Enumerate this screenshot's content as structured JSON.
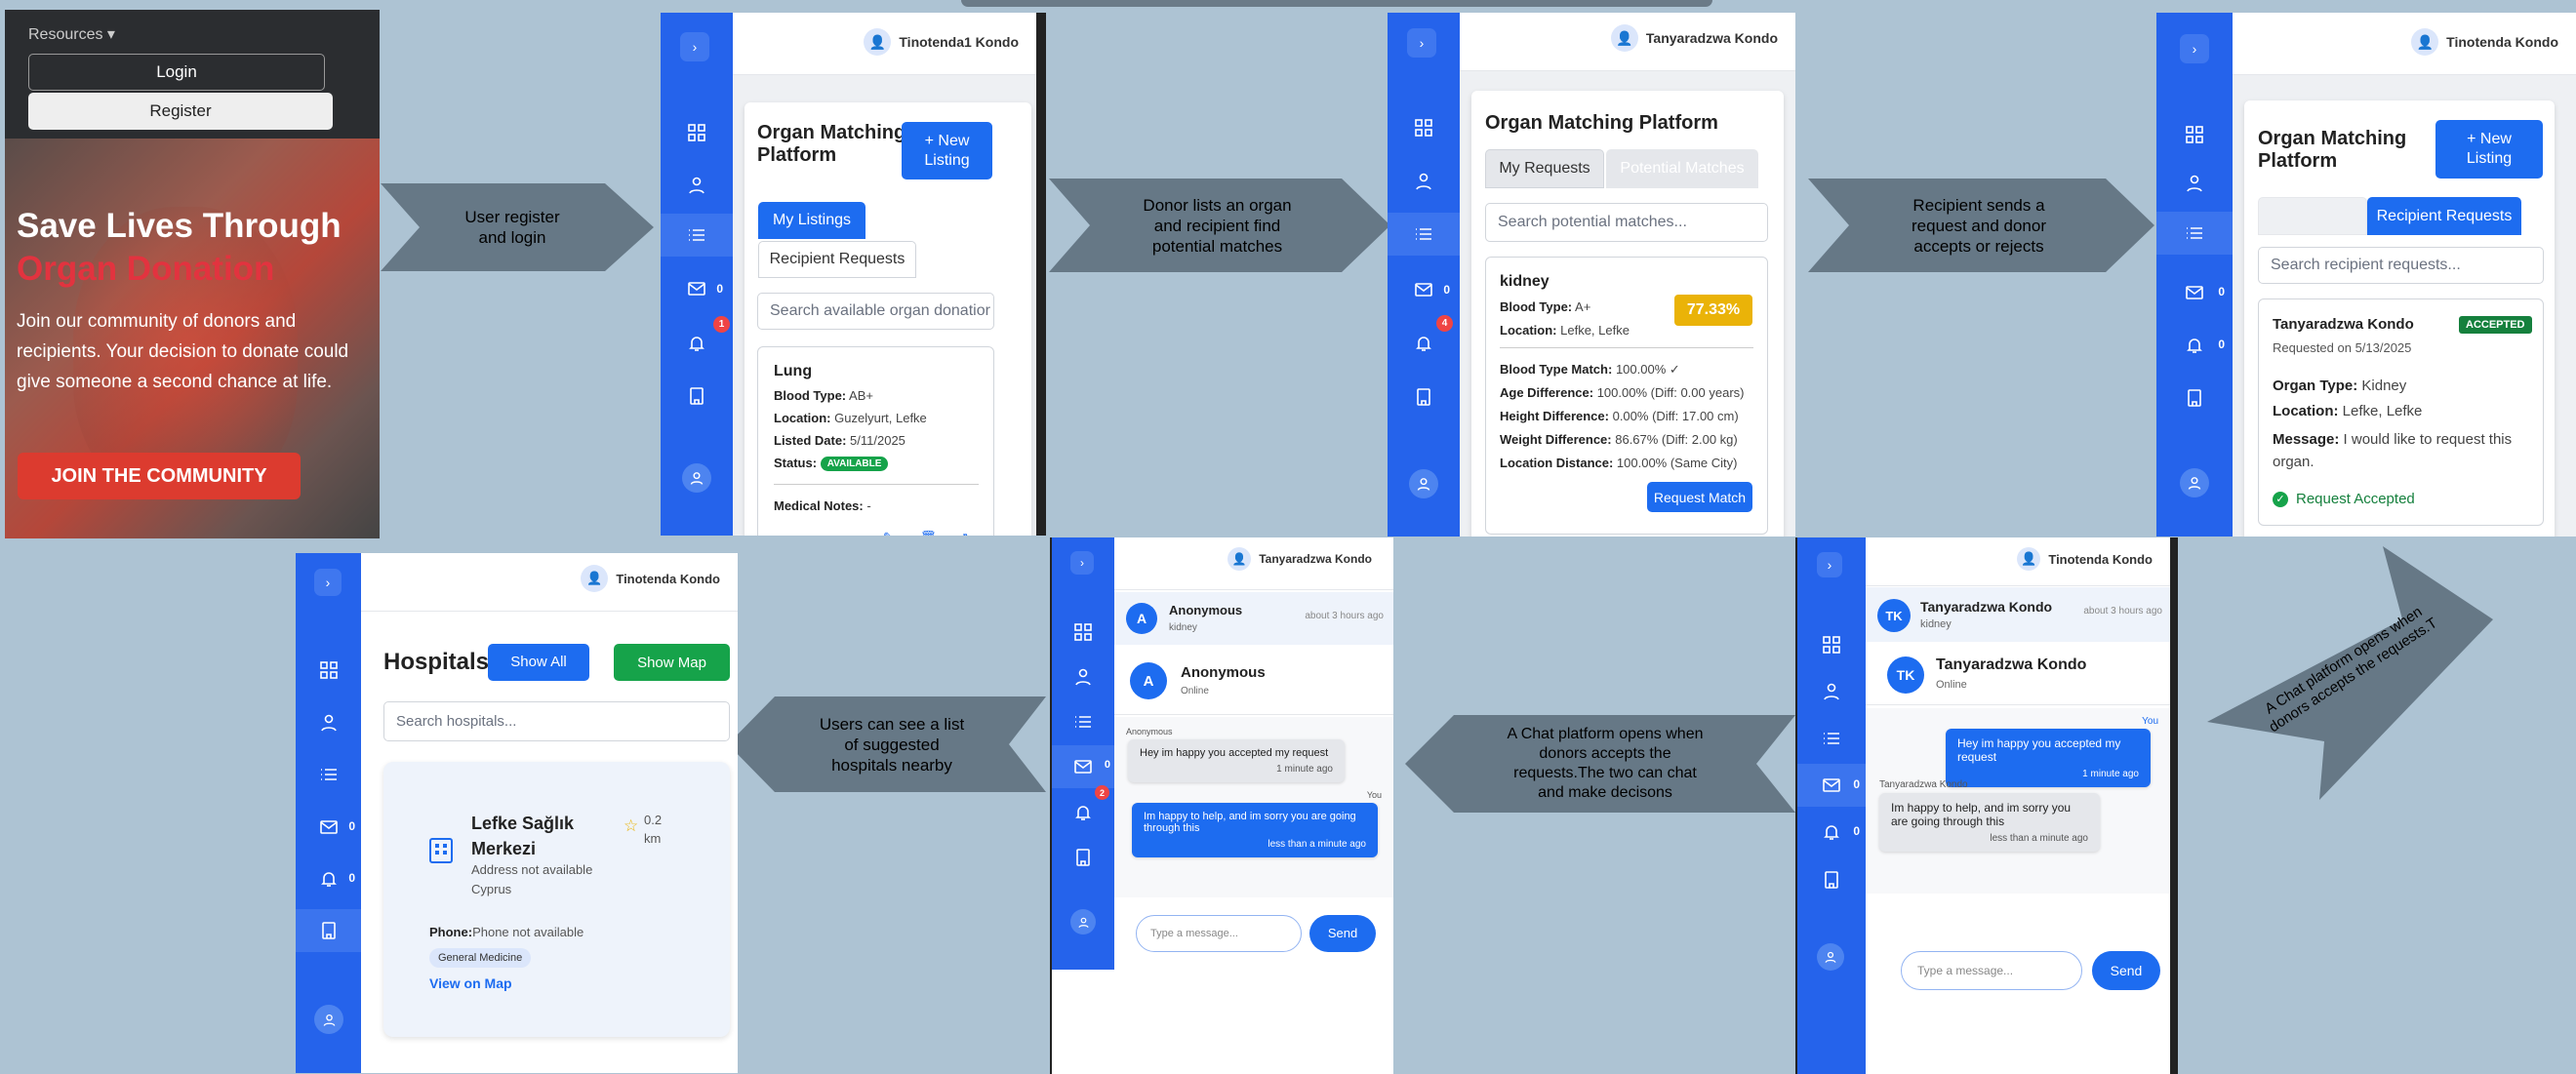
{
  "flow_labels": {
    "a1": [
      "User register",
      "and login"
    ],
    "a2": [
      "Donor lists an organ",
      "and recipient find",
      "potential matches"
    ],
    "a3": [
      "Recipient sends a",
      "request and donor",
      "accepts or rejects"
    ],
    "a4": [
      "A Chat platform opens when",
      "donors accepts the requests.T"
    ],
    "a5": [
      "A Chat platform opens when",
      "donors accepts the",
      "requests.The two can chat",
      "and make decisons"
    ],
    "a6": [
      "Users can see a list",
      "of suggested",
      "hospitals nearby"
    ]
  },
  "landing": {
    "resources": "Resources",
    "login": "Login",
    "register": "Register",
    "hero_line1": "Save Lives Through",
    "hero_line2": "Organ Donation",
    "body": "Join our community of donors and recipients. Your decision to donate could give someone a second chance at life.",
    "cta": "JOIN THE COMMUNITY"
  },
  "users": {
    "tinotenda1": "Tinotenda1 Kondo",
    "tanyaradzwa": "Tanyaradzwa Kondo",
    "tinotenda": "Tinotenda Kondo"
  },
  "platform_title": [
    "Organ Matching",
    "Platform"
  ],
  "platform_title_full": "Organ Matching Platform",
  "new_listing": [
    "+ New",
    "Listing"
  ],
  "s2": {
    "tab_my": "My Listings",
    "tab_req": "Recipient Requests",
    "search": "Search available organ donatior",
    "organ": "Lung",
    "blood_l": "Blood Type:",
    "blood": "AB+",
    "loc_l": "Location:",
    "loc": "Guzelyurt, Lefke",
    "date_l": "Listed Date:",
    "date": "5/11/2025",
    "status_l": "Status:",
    "status": "AVAILABLE",
    "notes_l": "Medical Notes:",
    "notes": "-",
    "mail_count": "0",
    "notif_badge": "1"
  },
  "s3": {
    "tab_my": "My Requests",
    "tab_pm": "Potential Matches",
    "search": "Search potential matches...",
    "organ": "kidney",
    "score": "77.33%",
    "blood_l": "Blood Type:",
    "blood": "A+",
    "loc_l": "Location:",
    "loc": "Lefke, Lefke",
    "m1_l": "Blood Type Match:",
    "m1": "100.00% ✓",
    "m2_l": "Age Difference:",
    "m2": "100.00% (Diff: 0.00 years)",
    "m3_l": "Height Difference:",
    "m3": "0.00% (Diff: 17.00 cm)",
    "m4_l": "Weight Difference:",
    "m4": "86.67% (Diff: 2.00 kg)",
    "m5_l": "Location Distance:",
    "m5": "100.00% (Same City)",
    "btn": "Request Match",
    "mail_count": "0",
    "notif_badge": "4"
  },
  "s4": {
    "tab_req": "Recipient Requests",
    "search": "Search recipient requests...",
    "name": "Tanyaradzwa Kondo",
    "badge": "ACCEPTED",
    "requested": "Requested on 5/13/2025",
    "type_l": "Organ Type:",
    "type": "Kidney",
    "loc_l": "Location:",
    "loc": "Lefke, Lefke",
    "msg_l": "Message:",
    "msg": "I would like to request this organ.",
    "accepted": "Request Accepted",
    "mail_count": "0",
    "notif_count": "0"
  },
  "s5": {
    "title": "Hospitals",
    "show_all": "Show All",
    "show_map": "Show Map",
    "search": "Search hospitals...",
    "hosp_name": [
      "Lefke Sağlık",
      "Merkezi"
    ],
    "dist": [
      "0.2",
      "km"
    ],
    "addr": "Address not available",
    "country": "Cyprus",
    "phone_l": "Phone:",
    "phone": "Phone not available",
    "tag": "General Medicine",
    "view": "View on Map",
    "mail_count": "0",
    "notif_count": "0"
  },
  "s6": {
    "conv_name": "Anonymous",
    "conv_sub": "kidney",
    "conv_time": "about 3 hours ago",
    "head_name": "Anonymous",
    "head_status": "Online",
    "avatar": "A",
    "in_sender": "Anonymous",
    "in_text": "Hey im happy you accepted my request",
    "in_time": "1 minute ago",
    "out_label": "You",
    "out_text": "Im happy to help, and im sorry you are going through this",
    "out_time": "less than a minute ago",
    "placeholder": "Type a message...",
    "send": "Send",
    "mail_count": "0",
    "notif_badge": "2"
  },
  "s7": {
    "conv_name": "Tanyaradzwa Kondo",
    "conv_sub": "kidney",
    "conv_time": "about 3 hours ago",
    "head_name": "Tanyaradzwa Kondo",
    "head_status": "Online",
    "avatar": "TK",
    "out_label": "You",
    "out_text": "Hey im happy you accepted my request",
    "out_time": "1 minute ago",
    "in_sender": "Tanyaradzwa Kondo",
    "in_text": "Im happy to help, and im sorry you are going through this",
    "in_time": "less than a minute ago",
    "placeholder": "Type a message...",
    "send": "Send",
    "mail_count": "0",
    "notif_count": "0"
  },
  "colors": {
    "brand_blue": "#2563eb",
    "accept_green": "#16a34a",
    "score_yellow": "#eab308",
    "danger_red": "#ef4444",
    "arrow_gray": "#667886"
  }
}
